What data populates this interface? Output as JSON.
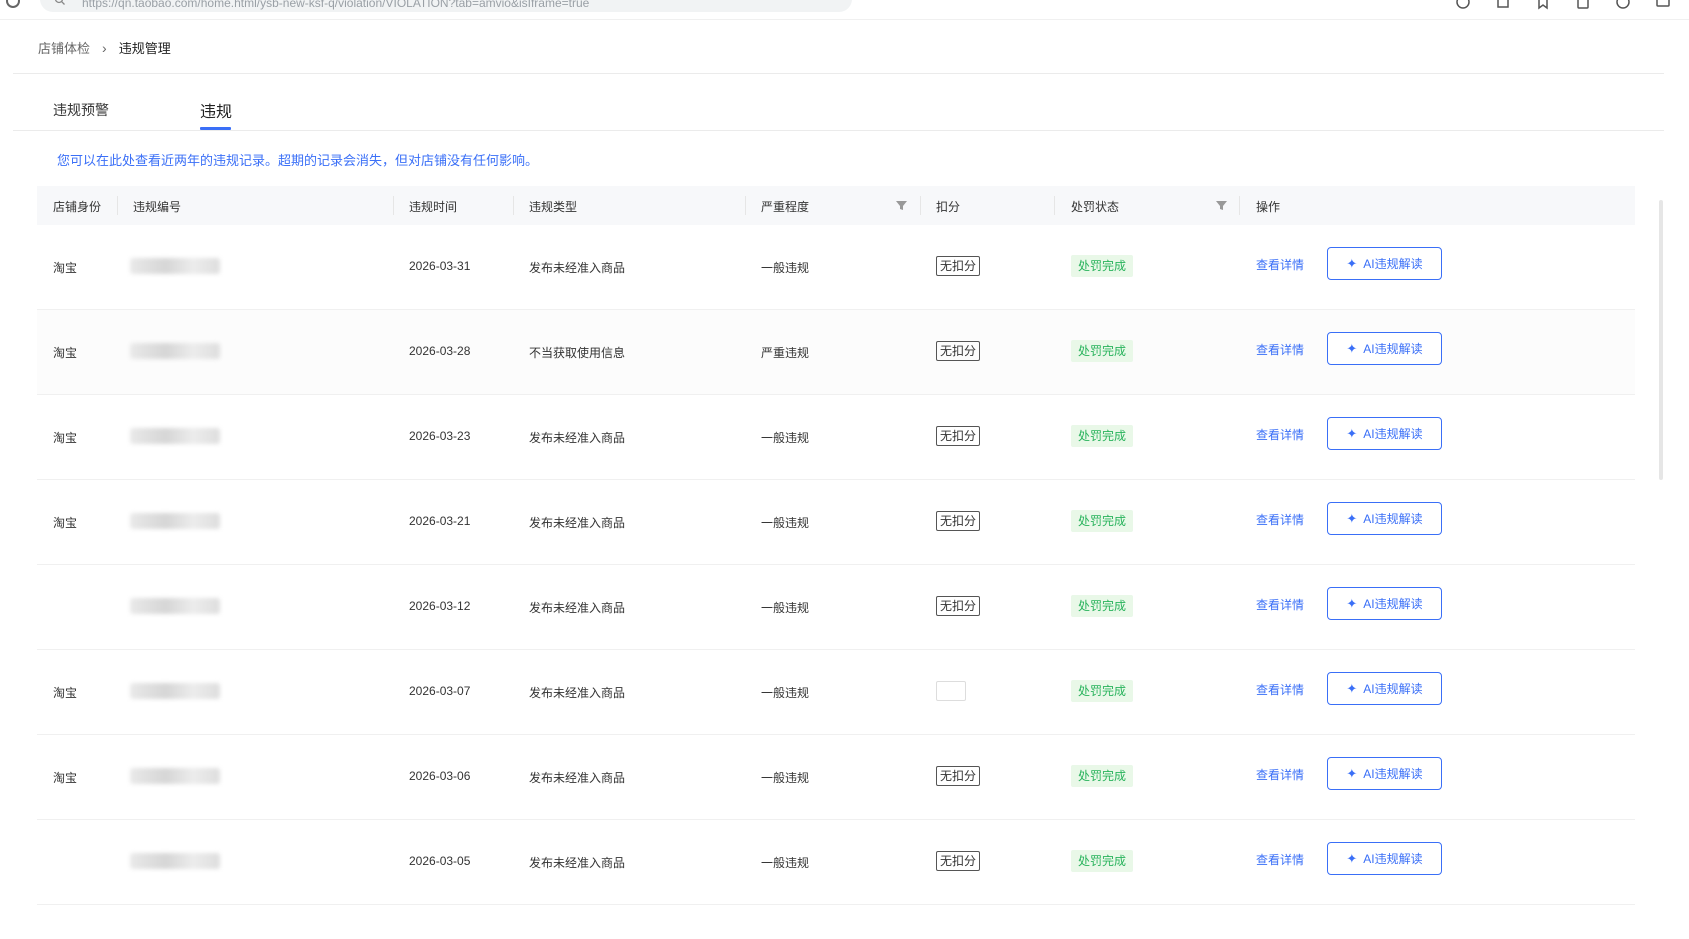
{
  "browser": {
    "url": "https://qn.taobao.com/home.html/ysb-new-ksf-q/violation/VIOLATION?tab=amvio&isIframe=true"
  },
  "breadcrumb": {
    "parent": "店铺体检",
    "separator": "›",
    "current": "违规管理"
  },
  "tabs": [
    {
      "label": "违规预警",
      "active": false
    },
    {
      "label": "违规",
      "active": true
    }
  ],
  "notice": "您可以在此处查看近两年的违规记录。超期的记录会消失，但对店铺没有任何影响。",
  "table": {
    "columns": [
      "店铺身份",
      "违规编号",
      "违规时间",
      "违规类型",
      "严重程度",
      "扣分",
      "处罚状态",
      "操作"
    ],
    "rows": [
      {
        "identity": "淘宝",
        "time": "2026-03-31",
        "type": "发布未经准入商品",
        "severity": "一般违规",
        "score": "无扣分",
        "status": "处罚完成",
        "detail": "查看详情",
        "ai": "AI违规解读"
      },
      {
        "identity": "淘宝",
        "time": "2026-03-28",
        "type": "不当获取使用信息",
        "severity": "严重违规",
        "score": "无扣分",
        "status": "处罚完成",
        "detail": "查看详情",
        "ai": "AI违规解读"
      },
      {
        "identity": "淘宝",
        "time": "2026-03-23",
        "type": "发布未经准入商品",
        "severity": "一般违规",
        "score": "无扣分",
        "status": "处罚完成",
        "detail": "查看详情",
        "ai": "AI违规解读"
      },
      {
        "identity": "淘宝",
        "time": "2026-03-21",
        "type": "发布未经准入商品",
        "severity": "一般违规",
        "score": "无扣分",
        "status": "处罚完成",
        "detail": "查看详情",
        "ai": "AI违规解读"
      },
      {
        "identity": "",
        "time": "2026-03-12",
        "type": "发布未经准入商品",
        "severity": "一般违规",
        "score": "无扣分",
        "status": "处罚完成",
        "detail": "查看详情",
        "ai": "AI违规解读"
      },
      {
        "identity": "淘宝",
        "time": "2026-03-07",
        "type": "发布未经准入商品",
        "severity": "一般违规",
        "score": "",
        "status": "处罚完成",
        "detail": "查看详情",
        "ai": "AI违规解读"
      },
      {
        "identity": "淘宝",
        "time": "2026-03-06",
        "type": "发布未经准入商品",
        "severity": "一般违规",
        "score": "无扣分",
        "status": "处罚完成",
        "detail": "查看详情",
        "ai": "AI违规解读"
      },
      {
        "identity": "",
        "time": "2026-03-05",
        "type": "发布未经准入商品",
        "severity": "一般违规",
        "score": "无扣分",
        "status": "处罚完成",
        "detail": "查看详情",
        "ai": "AI违规解读"
      }
    ]
  },
  "colors": {
    "accent": "#3a6ff7",
    "success_text": "#29b35c",
    "success_bg": "#e9f8e8"
  }
}
